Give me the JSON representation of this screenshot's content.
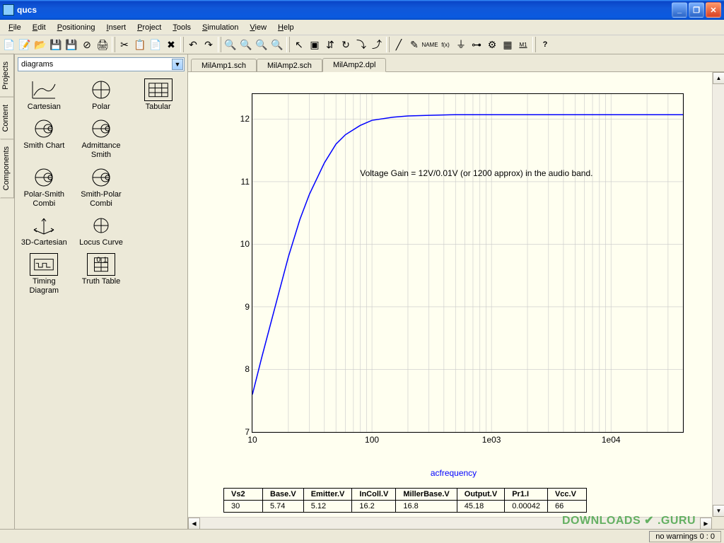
{
  "window": {
    "title": "qucs"
  },
  "menu": [
    "File",
    "Edit",
    "Positioning",
    "Insert",
    "Project",
    "Tools",
    "Simulation",
    "View",
    "Help"
  ],
  "sideTabs": [
    {
      "label": "Projects",
      "active": false
    },
    {
      "label": "Content",
      "active": false
    },
    {
      "label": "Components",
      "active": true
    }
  ],
  "combo": {
    "value": "diagrams"
  },
  "diagrams": [
    {
      "label": "Cartesian",
      "icon": "cartesian"
    },
    {
      "label": "Polar",
      "icon": "polar"
    },
    {
      "label": "Tabular",
      "icon": "tabular"
    },
    {
      "label": "Smith Chart",
      "icon": "smith"
    },
    {
      "label": "Admittance Smith",
      "icon": "admittance"
    },
    {
      "label": "",
      "icon": "blank"
    },
    {
      "label": "Polar-Smith Combi",
      "icon": "polar-smith"
    },
    {
      "label": "Smith-Polar Combi",
      "icon": "smith-polar"
    },
    {
      "label": "",
      "icon": "blank"
    },
    {
      "label": "3D-Cartesian",
      "icon": "3d"
    },
    {
      "label": "Locus Curve",
      "icon": "locus"
    },
    {
      "label": "",
      "icon": "blank"
    },
    {
      "label": "Timing Diagram",
      "icon": "timing"
    },
    {
      "label": "Truth Table",
      "icon": "truth"
    }
  ],
  "docTabs": [
    {
      "label": "MilAmp1.sch",
      "active": false
    },
    {
      "label": "MilAmp2.sch",
      "active": false
    },
    {
      "label": "MilAmp2.dpl",
      "active": true
    }
  ],
  "chart_data": {
    "type": "line",
    "x": [
      10,
      12,
      15,
      20,
      25,
      30,
      40,
      50,
      60,
      80,
      100,
      150,
      200,
      300,
      500,
      1000,
      3000,
      10000,
      40000
    ],
    "y": [
      7.6,
      8.2,
      8.9,
      9.8,
      10.4,
      10.8,
      11.3,
      11.6,
      11.75,
      11.9,
      11.98,
      12.03,
      12.05,
      12.06,
      12.07,
      12.07,
      12.07,
      12.07,
      12.07
    ],
    "xscale": "log",
    "xticks": [
      10,
      100,
      1000,
      10000
    ],
    "xtick_labels": [
      "10",
      "100",
      "1e03",
      "1e04"
    ],
    "yticks": [
      7,
      8,
      9,
      10,
      11,
      12
    ],
    "xlabel": "acfrequency",
    "annotation": "Voltage Gain = 12V/0.01V (or 1200 approx) in the audio band.",
    "xlim": [
      10,
      40000
    ],
    "ylim": [
      7,
      12.4
    ]
  },
  "table": {
    "headers": [
      "Vs2",
      "Base.V",
      "Emitter.V",
      "InColl.V",
      "MillerBase.V",
      "Output.V",
      "Pr1.I",
      "Vcc.V"
    ],
    "rows": [
      [
        "30",
        "5.74",
        "5.12",
        "16.2",
        "16.8",
        "45.18",
        "0.00042",
        "66"
      ]
    ]
  },
  "status": {
    "warnings": "no warnings 0 : 0"
  },
  "watermark": "DOWNLOADS ✔ .GURU"
}
